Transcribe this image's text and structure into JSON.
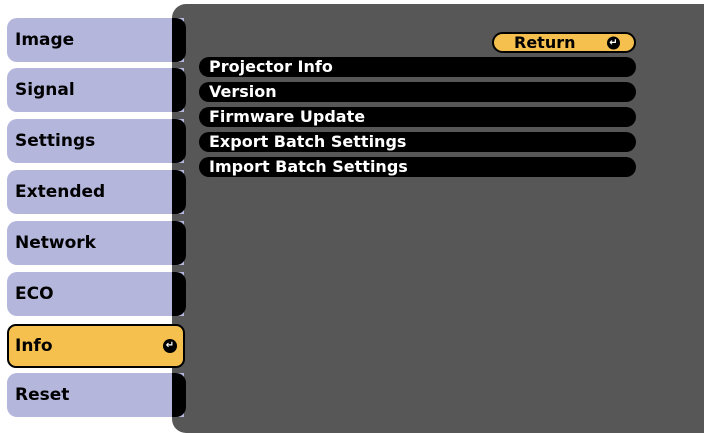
{
  "sidebar": {
    "items": [
      {
        "label": "Image"
      },
      {
        "label": "Signal"
      },
      {
        "label": "Settings"
      },
      {
        "label": "Extended"
      },
      {
        "label": "Network"
      },
      {
        "label": "ECO"
      },
      {
        "label": "Info",
        "active": true
      },
      {
        "label": "Reset"
      }
    ]
  },
  "content": {
    "return_label": "Return",
    "items": [
      {
        "label": "Projector Info"
      },
      {
        "label": "Version"
      },
      {
        "label": "Firmware Update"
      },
      {
        "label": "Export Batch Settings"
      },
      {
        "label": "Import Batch Settings"
      }
    ]
  },
  "icons": {
    "enter": "enter-icon"
  },
  "colors": {
    "tab_bg": "#b4b6dc",
    "active_bg": "#f5c04e",
    "panel_bg": "#575757",
    "item_bg": "#000000"
  }
}
